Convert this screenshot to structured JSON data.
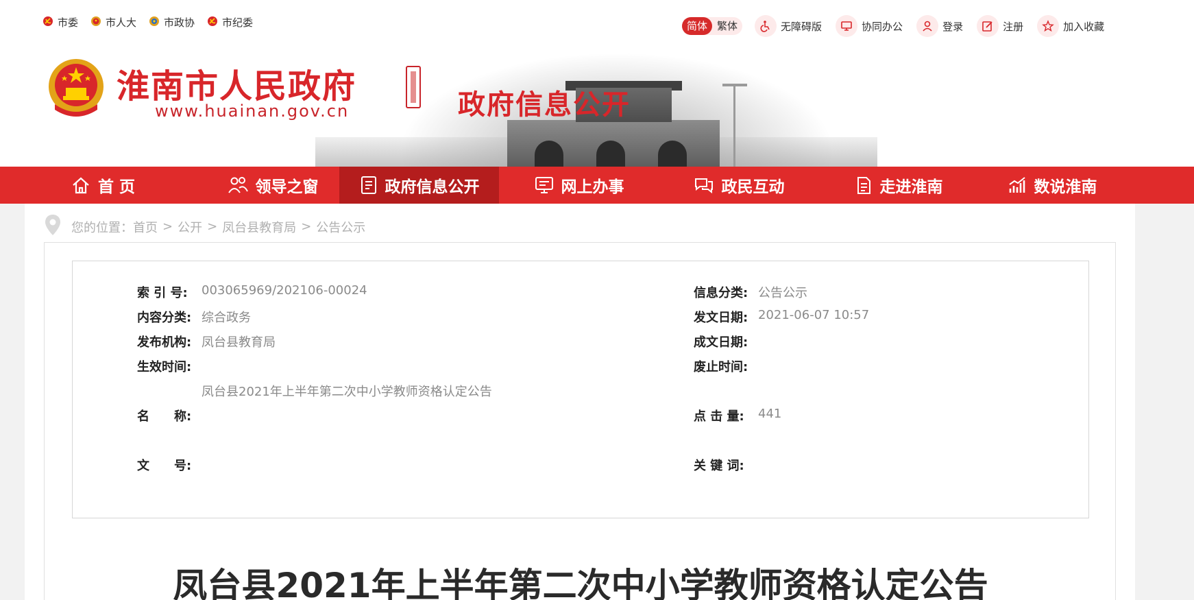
{
  "top_links": [
    {
      "label": "市委"
    },
    {
      "label": "市人大"
    },
    {
      "label": "市政协"
    },
    {
      "label": "市纪委"
    }
  ],
  "utility": {
    "lang_simplified": "简体",
    "lang_traditional": "繁体",
    "accessible": "无障碍版",
    "office": "协同办公",
    "login": "登录",
    "register": "注册",
    "favorite": "加入收藏"
  },
  "brand": {
    "site_name": "淮南市人民政府",
    "url": "www.huainan.gov.cn",
    "section_title": "政府信息公开",
    "accent_color": "#e02b2b"
  },
  "nav": [
    {
      "label": "首 页",
      "icon": "home-icon"
    },
    {
      "label": "领导之窗",
      "icon": "people-icon"
    },
    {
      "label": "政府信息公开",
      "icon": "document-icon",
      "active": true
    },
    {
      "label": "网上办事",
      "icon": "monitor-icon"
    },
    {
      "label": "政民互动",
      "icon": "chat-icon"
    },
    {
      "label": "走进淮南",
      "icon": "book-icon"
    },
    {
      "label": "数说淮南",
      "icon": "chart-icon"
    }
  ],
  "breadcrumb": {
    "prefix": "您的位置：",
    "items": [
      "首页",
      "公开",
      "凤台县教育局",
      "公告公示"
    ],
    "separator": ">"
  },
  "meta": {
    "index_no": {
      "label": "索 引 号:",
      "value": "003065969/202106-00024"
    },
    "info_category": {
      "label": "信息分类:",
      "value": "公告公示"
    },
    "content_category": {
      "label": "内容分类:",
      "value": "综合政务"
    },
    "publish_date": {
      "label": "发文日期:",
      "value": "2021-06-07 10:57"
    },
    "publisher": {
      "label": "发布机构:",
      "value": "凤台县教育局"
    },
    "created_date": {
      "label": "成文日期:",
      "value": ""
    },
    "effective_time": {
      "label": "生效时间:",
      "value": ""
    },
    "expire_time": {
      "label": "废止时间:",
      "value": ""
    },
    "name": {
      "label": "名　　称:",
      "value": "凤台县2021年上半年第二次中小学教师资格认定公告"
    },
    "clicks": {
      "label": "点 击 量:",
      "value": "441"
    },
    "doc_no": {
      "label": "文　　号:",
      "value": ""
    },
    "keywords": {
      "label": "关 键 词:",
      "value": ""
    }
  },
  "document": {
    "title": "凤台县2021年上半年第二次中小学教师资格认定公告"
  }
}
